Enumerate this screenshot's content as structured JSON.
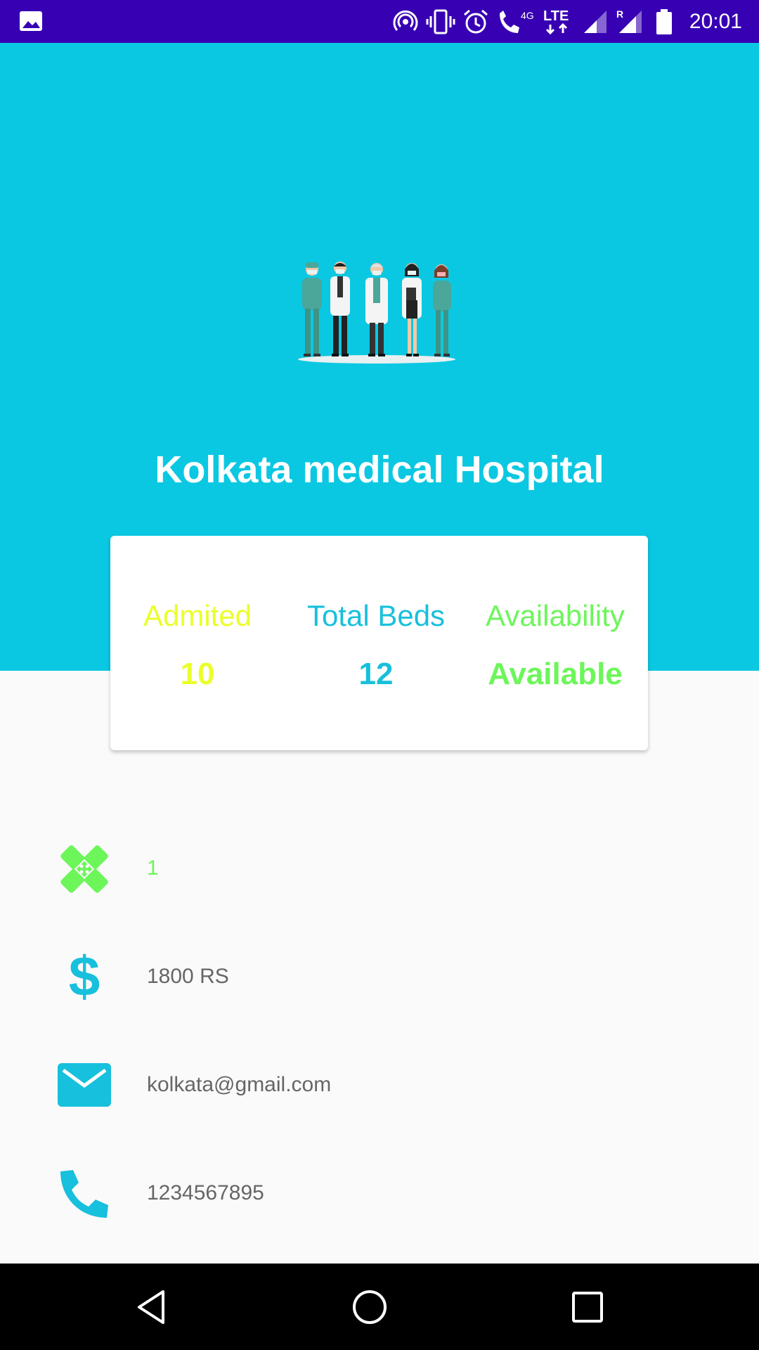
{
  "status_bar": {
    "time": "20:01",
    "network_label": "LTE",
    "data_label": "4G",
    "roaming_label": "R",
    "icons": [
      "image-icon",
      "hotspot-icon",
      "vibrate-icon",
      "alarm-icon",
      "wifi-call-icon",
      "lte-icon",
      "signal-icon",
      "roaming-signal-icon",
      "battery-icon"
    ]
  },
  "header": {
    "hospital_name": "Kolkata medical Hospital",
    "background_color": "#0bc8e2",
    "illustration": "doctors-illustration"
  },
  "stats": {
    "admitted_label": "Admited",
    "admitted_value": "10",
    "total_beds_label": "Total Beds",
    "total_beds_value": "12",
    "availability_label": "Availability",
    "availability_value": "Available",
    "colors": {
      "admitted": "#eaff2a",
      "total_beds": "#17c0dc",
      "availability": "#6cf65a"
    }
  },
  "info": {
    "bandage_value": "1",
    "price": "1800 RS",
    "email": "kolkata@gmail.com",
    "phone": "1234567895"
  },
  "nav": {
    "icons": [
      "back-icon",
      "home-icon",
      "recents-icon"
    ]
  }
}
